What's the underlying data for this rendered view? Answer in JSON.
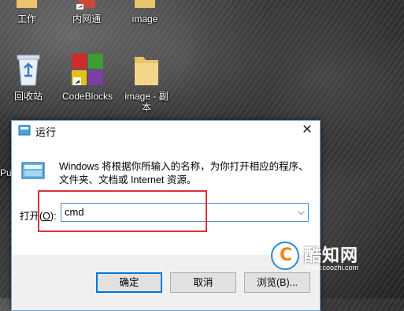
{
  "desktop": {
    "icons": [
      {
        "label": "工作",
        "icon": "folder-icon"
      },
      {
        "label": "内网通",
        "icon": "network-app-icon"
      },
      {
        "label": "image",
        "icon": "folder-icon"
      },
      {
        "label": "回收站",
        "icon": "recycle-bin-icon"
      },
      {
        "label": "CodeBlocks",
        "icon": "codeblocks-icon"
      },
      {
        "label": "image - 副本",
        "icon": "folder-icon"
      }
    ],
    "partial_label": "Pu"
  },
  "run_dialog": {
    "title": "运行",
    "close_glyph": "✕",
    "description": "Windows 将根据你所输入的名称，为你打开相应的程序、文件夹、文档或 Internet 资源。",
    "open_label_prefix": "打开(",
    "open_label_key": "O",
    "open_label_suffix": "):",
    "command_value": "cmd",
    "ok_label": "确定",
    "cancel_label": "取消",
    "browse_label": "浏览(B)...",
    "highlight_color": "#d9343a"
  },
  "watermark": {
    "name": "酷知网",
    "url": "www.coozhi.com"
  }
}
